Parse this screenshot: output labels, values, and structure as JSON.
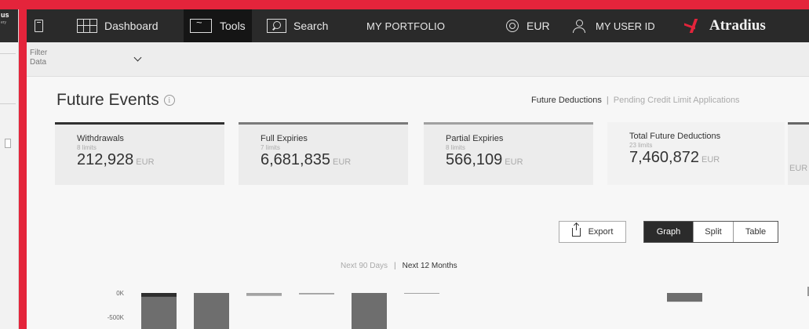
{
  "left_window": {
    "brand": "us",
    "brand_tagline": "ery"
  },
  "topbar": {
    "dashboard_label": "Dashboard",
    "tools_label": "Tools",
    "search_label": "Search",
    "portfolio_label": "MY PORTFOLIO",
    "currency_label": "EUR",
    "user_label": "MY USER ID",
    "brand_name": "Atradius"
  },
  "filter": {
    "label_line1": "Filter",
    "label_line2": "Data"
  },
  "page": {
    "title": "Future Events",
    "link_active": "Future Deductions",
    "link_separator": "|",
    "link_inactive": "Pending Credit Limit Applications"
  },
  "cards": [
    {
      "label": "Withdrawals",
      "sub": "8 limits",
      "value": "212,928",
      "currency": "EUR"
    },
    {
      "label": "Full Expiries",
      "sub": "7 limits",
      "value": "6,681,835",
      "currency": "EUR"
    },
    {
      "label": "Partial Expiries",
      "sub": "8 limits",
      "value": "566,109",
      "currency": "EUR"
    },
    {
      "label": "Total Future Deductions",
      "sub": "23 limits",
      "value": "7,460,872",
      "currency": "EUR"
    }
  ],
  "partial_card": {
    "currency": "EUR"
  },
  "export_label": "Export",
  "view_options": {
    "graph": "Graph",
    "split": "Split",
    "table": "Table",
    "selected": "Graph"
  },
  "period": {
    "inactive": "Next 90 Days",
    "separator": "|",
    "active": "Next 12 Months"
  },
  "chart_data": {
    "type": "bar",
    "y_ticks": [
      "0K",
      "-500K"
    ],
    "stacked_series_colors": [
      "#2e2e2e",
      "#6e6e6e",
      "#a3a3a3"
    ],
    "bars": [
      {
        "segments": [
          {
            "color": "#2e2e2e",
            "value": -80000
          },
          {
            "color": "#6e6e6e",
            "value": -420000
          }
        ]
      },
      {
        "segments": [
          {
            "color": "#6e6e6e",
            "value": -500000
          }
        ]
      },
      {
        "segments": [
          {
            "color": "#a3a3a3",
            "value": -60000
          }
        ]
      },
      {
        "segments": [
          {
            "color": "#a3a3a3",
            "value": -30000
          }
        ]
      },
      {
        "segments": [
          {
            "color": "#6e6e6e",
            "value": -500000
          }
        ]
      },
      {
        "segments": [
          {
            "color": "#a3a3a3",
            "value": -5000
          }
        ]
      },
      {
        "segments": []
      },
      {
        "segments": []
      },
      {
        "segments": []
      },
      {
        "segments": []
      },
      {
        "segments": [
          {
            "color": "#6e6e6e",
            "value": -180000
          }
        ]
      },
      {
        "segments": []
      }
    ]
  }
}
